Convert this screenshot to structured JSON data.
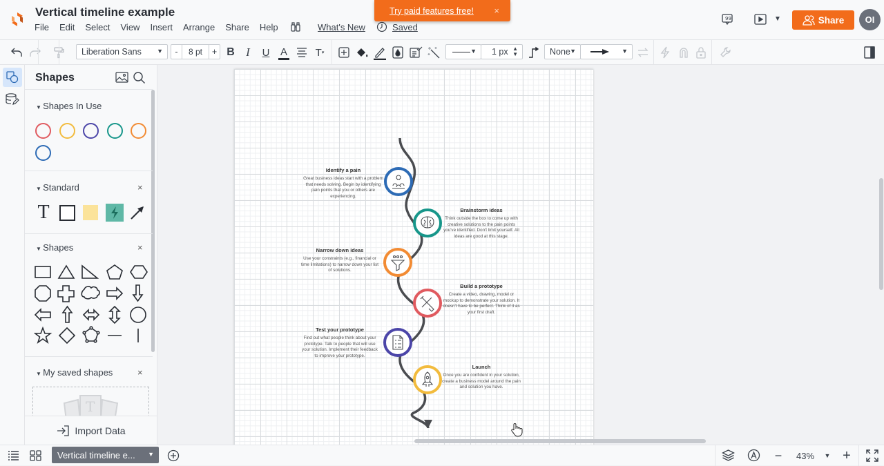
{
  "app": {
    "document_title": "Vertical timeline example",
    "menu": [
      "File",
      "Edit",
      "Select",
      "View",
      "Insert",
      "Arrange",
      "Share",
      "Help"
    ],
    "whats_new": "What's New",
    "saved_status": "Saved",
    "promo_text": "Try paid features free!",
    "promo_close": "×",
    "share_label": "Share",
    "avatar_initials": "OI",
    "brand_color": "#f26c1b"
  },
  "toolbar": {
    "font_family": "Liberation Sans",
    "font_size": "8 pt",
    "font_size_minus": "-",
    "font_size_plus": "+",
    "bold": "B",
    "italic": "I",
    "underline": "U",
    "text_color": "A",
    "line_width": "1 px",
    "line_start": "None"
  },
  "sidebar": {
    "title": "Shapes",
    "sections": [
      {
        "label": "Shapes In Use",
        "closable": false
      },
      {
        "label": "Standard",
        "closable": true
      },
      {
        "label": "Shapes",
        "closable": true
      },
      {
        "label": "My saved shapes",
        "closable": true
      }
    ],
    "close_glyph": "×",
    "shapes_in_use_colors": [
      "#e05a5f",
      "#f2bb3d",
      "#4b45a8",
      "#17968a",
      "#f28b33",
      "#2d6bb5"
    ],
    "import_label": "Import Data"
  },
  "timeline": {
    "steps": [
      {
        "title": "Identify a pain",
        "desc": "Great business ideas start with a problem that needs solving. Begin by identifying pain points that you or others are experiencing.",
        "color": "#2d6bb5",
        "icon": "people-idea-icon",
        "side": "left"
      },
      {
        "title": "Brainstorm ideas",
        "desc": "Think outside the box to come up with creative solutions to the pain points you've identified. Don't limit yourself. All ideas are good at this stage.",
        "color": "#17968a",
        "icon": "brain-icon",
        "side": "right"
      },
      {
        "title": "Narrow down ideas",
        "desc": "Use your constraints (e.g., financial or time limitations) to narrow down your list of solutions.",
        "color": "#f28b33",
        "icon": "funnel-icon",
        "side": "left"
      },
      {
        "title": "Build a prototype",
        "desc": "Create a video, drawing, model or mockup to demonstrate your solution. It doesn't have to be perfect. Think of it as your first draft.",
        "color": "#e05a5f",
        "icon": "tools-icon",
        "side": "right"
      },
      {
        "title": "Test your prototype",
        "desc": "Find out what people think about your prototype. Talk to people that will use your solution. Implement their feedback to improve your prototype.",
        "color": "#4b45a8",
        "icon": "checklist-icon",
        "side": "left"
      },
      {
        "title": "Launch",
        "desc": "Once you are confident in your solution, create a business model around the pain and solution you have.",
        "color": "#f2bb3d",
        "icon": "rocket-icon",
        "side": "right"
      }
    ]
  },
  "bottombar": {
    "page_tab": "Vertical timeline e...",
    "zoom": "43%",
    "zoom_minus": "−",
    "zoom_plus": "+"
  }
}
